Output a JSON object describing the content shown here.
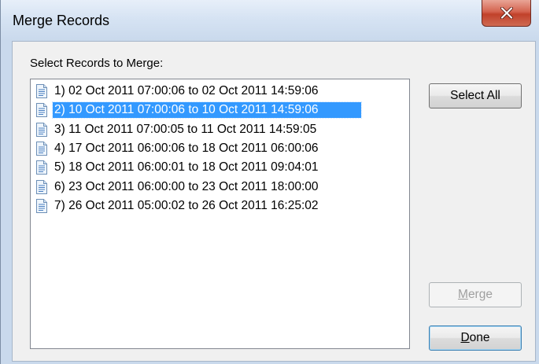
{
  "window": {
    "title": "Merge Records",
    "close_label": "X"
  },
  "dialog": {
    "list_label": "Select Records to Merge:",
    "records": [
      {
        "label": "1) 02 Oct 2011 07:00:06 to 02 Oct 2011 14:59:06",
        "selected": false
      },
      {
        "label": "2) 10 Oct 2011 07:00:06 to 10 Oct 2011 14:59:06",
        "selected": true
      },
      {
        "label": "3) 11 Oct 2011 07:00:05 to 11 Oct 2011 14:59:05",
        "selected": false
      },
      {
        "label": "4) 17 Oct 2011 06:00:06 to 18 Oct 2011 06:00:06",
        "selected": false
      },
      {
        "label": "5) 18 Oct 2011 06:00:01 to 18 Oct 2011 09:04:01",
        "selected": false
      },
      {
        "label": "6) 23 Oct 2011 06:00:00 to 23 Oct 2011 18:00:00",
        "selected": false
      },
      {
        "label": "7) 26 Oct 2011 05:00:02 to 26 Oct 2011 16:25:02",
        "selected": false
      }
    ],
    "record_icon": "document-icon",
    "buttons": {
      "select_all": "Select All",
      "merge_mnemonic": "M",
      "merge_rest": "erge",
      "merge_enabled": false,
      "done_mnemonic": "D",
      "done_rest": "one"
    }
  },
  "colors": {
    "selection": "#3399ff",
    "close_button": "#c7432d"
  }
}
